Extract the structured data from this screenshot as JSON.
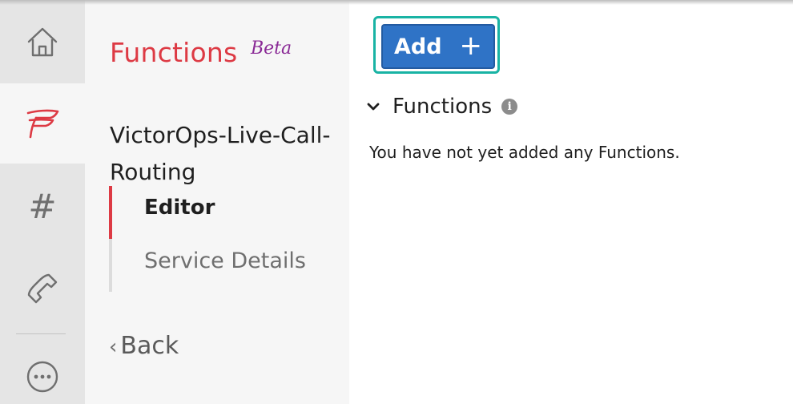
{
  "rail": {
    "items": [
      {
        "icon": "home-icon"
      },
      {
        "icon": "functions-icon",
        "active": true
      },
      {
        "icon": "hash-icon",
        "glyph": "#"
      },
      {
        "icon": "phone-icon"
      },
      {
        "icon": "more-icon"
      }
    ]
  },
  "subnav": {
    "app_title": "Functions",
    "app_badge": "Beta",
    "service_name": "VictorOps-Live-Call-Routing",
    "links": [
      {
        "label": "Editor",
        "active": true
      },
      {
        "label": "Service Details",
        "active": false
      }
    ],
    "back_chevron": "‹",
    "back_label": "Back"
  },
  "main": {
    "add_button": {
      "label": "Add",
      "icon": "plus-icon",
      "glyph": "+"
    },
    "section": {
      "title": "Functions",
      "caret_icon": "chevron-down-icon",
      "info_icon": "info-icon",
      "info_glyph": "i"
    },
    "empty_message": "You have not yet added any Functions."
  },
  "colors": {
    "brand_red": "#dd3a44",
    "beta_purple": "#8a2a96",
    "button_blue": "#2f73c6",
    "highlight_teal": "#19b3a4",
    "rail_bg": "#e5e5e5",
    "subnav_bg": "#f6f6f6"
  }
}
